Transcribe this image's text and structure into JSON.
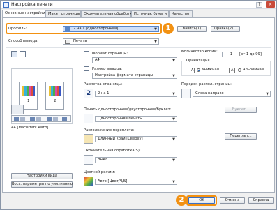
{
  "window": {
    "title": "Настройка печати",
    "help_label": "?",
    "close_label": "×"
  },
  "tabs": [
    {
      "label": "Основные настройки"
    },
    {
      "label": "Макет страницы"
    },
    {
      "label": "Окончательная обработка"
    },
    {
      "label": "Источник бумаги"
    },
    {
      "label": "Качество"
    }
  ],
  "profile": {
    "label": "Профиль:",
    "value": "2 на 1 [односторонняя]",
    "add_label": "...бавить(1)...",
    "edit_label": "Правка(2)..."
  },
  "output": {
    "label": "Способ вывода:",
    "value": "Печать"
  },
  "preview": {
    "page_left_num": "1",
    "page_right_num": "2",
    "status_text": "A4 [Масштаб: Авто]",
    "view_settings_button": "Настройки вида",
    "restore_defaults_button": "Восс. параметры по умолчанию"
  },
  "page_format": {
    "label": "Формат страницы:",
    "value": "A4"
  },
  "output_size": {
    "label": "Размер вывода:",
    "value": "Настройка формата страницы"
  },
  "copies": {
    "label": "Количество копий:",
    "value": "1",
    "range": "[от 1 до 99]"
  },
  "orientation": {
    "label": "Ориентация",
    "portrait_label": "Книжная",
    "landscape_label": "Альбомная"
  },
  "layout": {
    "label": "Разметка страницы:",
    "icon_text": "2",
    "value": "2 на 1"
  },
  "page_order": {
    "label": "Порядок распол. страниц:",
    "value": "Слева направо"
  },
  "booklet": {
    "button": "Буклет..."
  },
  "duplex": {
    "label": "Печать односторонняя/двусторонняя/буклет:",
    "value": "Односторонняя печать"
  },
  "binding": {
    "label": "Расположение переплета:",
    "value": "Длинный край [Сверху]",
    "margin_button": "Переплет..."
  },
  "finishing": {
    "label": "Окончательная обработка(S):",
    "value": "Выкл."
  },
  "color": {
    "label": "Цветной режим:",
    "value": "Авто [Цвет/Ч/Б]"
  },
  "footer": {
    "ok_label": "OK",
    "cancel_label": "Отмена",
    "help_label": "Справка"
  },
  "callouts": {
    "first": "1",
    "second": "2"
  },
  "accent_color": "#f29112"
}
